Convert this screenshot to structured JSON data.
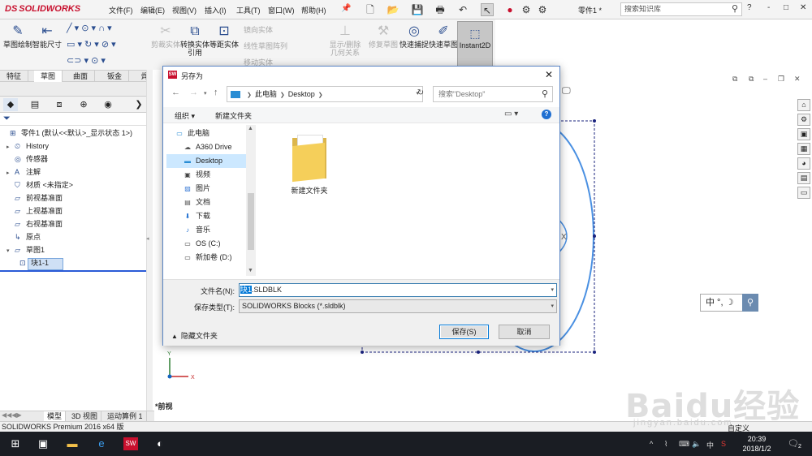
{
  "app": {
    "logo_text": "SOLIDWORKS",
    "menus": [
      "文件(F)",
      "编辑(E)",
      "视图(V)",
      "插入(I)",
      "工具(T)",
      "窗口(W)",
      "帮助(H)"
    ],
    "document_title": "零件1 *",
    "search_placeholder": "搜索知识库",
    "window_controls": [
      "?",
      "-",
      "□",
      "✕"
    ]
  },
  "ribbon": {
    "buttons": [
      {
        "label": "草图绘制",
        "icon": "sketch-icon",
        "enabled": true
      },
      {
        "label": "智能尺寸",
        "icon": "smart-dimension-icon",
        "enabled": true
      },
      {
        "label": "剪裁实体",
        "icon": "trim-icon",
        "enabled": false
      },
      {
        "label": "转换实体引用",
        "icon": "convert-icon",
        "enabled": true
      },
      {
        "label": "等距实体",
        "icon": "offset-icon",
        "enabled": true
      },
      {
        "label": "显示/删除几何关系",
        "icon": "relations-icon",
        "enabled": false
      },
      {
        "label": "修复草图",
        "icon": "repair-icon",
        "enabled": false
      },
      {
        "label": "快速捕捉",
        "icon": "snap-icon",
        "enabled": true
      },
      {
        "label": "快速草图",
        "icon": "rapid-sketch-icon",
        "enabled": true
      }
    ],
    "small_items": [
      "镜向实体",
      "线性草图阵列",
      "移动实体"
    ],
    "instant2d_label": "Instant2D"
  },
  "tabs": [
    "特征",
    "草图",
    "曲面",
    "钣金",
    "焊件"
  ],
  "active_tab": "草图",
  "tree": {
    "items": [
      {
        "label": "零件1 (默认<<默认>_显示状态 1>)",
        "level": 0,
        "expander": ""
      },
      {
        "label": "History",
        "level": 1,
        "expander": "▸"
      },
      {
        "label": "传感器",
        "level": 1,
        "expander": ""
      },
      {
        "label": "注解",
        "level": 1,
        "expander": "▸"
      },
      {
        "label": "材质 <未指定>",
        "level": 1,
        "expander": ""
      },
      {
        "label": "前视基准面",
        "level": 1,
        "expander": ""
      },
      {
        "label": "上视基准面",
        "level": 1,
        "expander": ""
      },
      {
        "label": "右视基准面",
        "level": 1,
        "expander": ""
      },
      {
        "label": "原点",
        "level": 1,
        "expander": ""
      },
      {
        "label": "草图1",
        "level": 1,
        "expander": "▾"
      },
      {
        "label": "块1-1",
        "level": 2,
        "expander": ""
      }
    ]
  },
  "graphics": {
    "view_label": "*前视"
  },
  "bottom_tabs": [
    "模型",
    "3D 视图",
    "运动算例 1"
  ],
  "active_bottom_tab": "模型",
  "status_bar": {
    "left": "SOLIDWORKS Premium 2016 x64 版",
    "right": "自定义"
  },
  "ime": {
    "text": "中 °, ☽"
  },
  "dialog": {
    "title": "另存为",
    "address": {
      "root": "此电脑",
      "folder": "Desktop"
    },
    "search_placeholder": "搜索\"Desktop\"",
    "toolbar": {
      "organize": "组织 ▾",
      "new_folder": "新建文件夹"
    },
    "nav_items": [
      {
        "label": "此电脑",
        "icon": "pc-icon"
      },
      {
        "label": "A360 Drive",
        "icon": "cloud-icon"
      },
      {
        "label": "Desktop",
        "icon": "desktop-icon"
      },
      {
        "label": "视频",
        "icon": "video-icon"
      },
      {
        "label": "图片",
        "icon": "pictures-icon"
      },
      {
        "label": "文档",
        "icon": "documents-icon"
      },
      {
        "label": "下载",
        "icon": "download-icon"
      },
      {
        "label": "音乐",
        "icon": "music-icon"
      },
      {
        "label": "OS (C:)",
        "icon": "drive-icon"
      },
      {
        "label": "新加卷 (D:)",
        "icon": "drive-icon"
      }
    ],
    "selected_nav": "Desktop",
    "files": [
      {
        "label": "新建文件夹",
        "type": "folder"
      }
    ],
    "filename_label": "文件名(N):",
    "filename_selected": "块1",
    "filename_rest": ".SLDBLK",
    "filetype_label": "保存类型(T):",
    "filetype_value": "SOLIDWORKS Blocks (*.sldblk)",
    "hide_folders": "隐藏文件夹",
    "save_button": "保存(S)",
    "cancel_button": "取消"
  },
  "taskbar": {
    "clock_time": "20:39",
    "clock_date": "2018/1/2",
    "ime_indicator": "中",
    "notification_count": "2"
  },
  "watermark": {
    "brand": "Baidu经验",
    "url": "jingyan.baidu.com"
  }
}
